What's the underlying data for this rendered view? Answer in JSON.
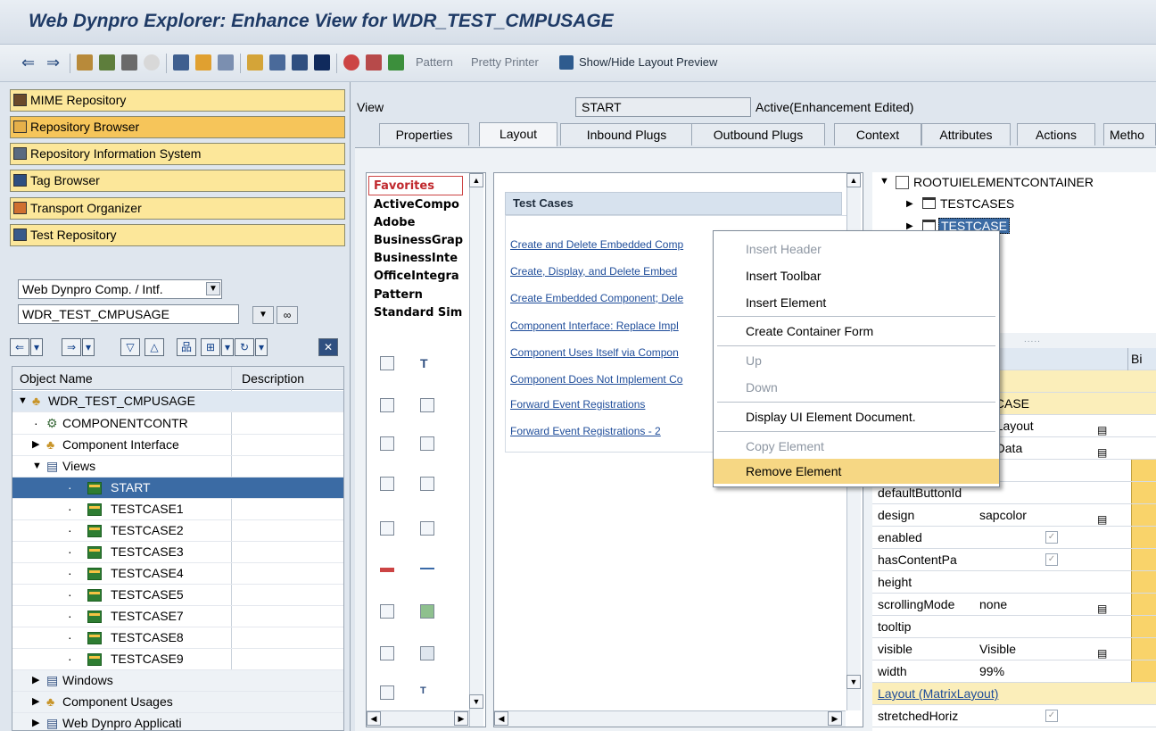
{
  "window": {
    "title": "Web Dynpro Explorer: Enhance View for WDR_TEST_CMPUSAGE"
  },
  "toolbar": {
    "pattern_label": "Pattern",
    "pretty_printer_label": "Pretty Printer",
    "layout_preview_label": "Show/Hide Layout Preview"
  },
  "nav": {
    "items": [
      {
        "label": "MIME Repository"
      },
      {
        "label": "Repository Browser"
      },
      {
        "label": "Repository Information System"
      },
      {
        "label": "Tag Browser"
      },
      {
        "label": "Transport Organizer"
      },
      {
        "label": "Test Repository"
      }
    ],
    "object_type": "Web Dynpro Comp. / Intf.",
    "object_name": "WDR_TEST_CMPUSAGE"
  },
  "object_tree": {
    "col_name": "Object Name",
    "col_desc": "Description",
    "rows": [
      {
        "label": "WDR_TEST_CMPUSAGE"
      },
      {
        "label": "COMPONENTCONTR"
      },
      {
        "label": "Component Interface"
      },
      {
        "label": "Views"
      },
      {
        "label": "START"
      },
      {
        "label": "TESTCASE1"
      },
      {
        "label": "TESTCASE2"
      },
      {
        "label": "TESTCASE3"
      },
      {
        "label": "TESTCASE4"
      },
      {
        "label": "TESTCASE5"
      },
      {
        "label": "TESTCASE7"
      },
      {
        "label": "TESTCASE8"
      },
      {
        "label": "TESTCASE9"
      },
      {
        "label": "Windows"
      },
      {
        "label": "Component Usages"
      },
      {
        "label": "Web Dynpro Applicati"
      }
    ]
  },
  "view_header": {
    "view_label": "View",
    "view_name": "START",
    "status": "Active(Enhancement Edited)"
  },
  "tabs": [
    {
      "label": "Properties"
    },
    {
      "label": "Layout"
    },
    {
      "label": "Inbound Plugs"
    },
    {
      "label": "Outbound Plugs"
    },
    {
      "label": "Context"
    },
    {
      "label": "Attributes"
    },
    {
      "label": "Actions"
    },
    {
      "label": "Metho"
    }
  ],
  "palette": {
    "items": [
      {
        "label": "Favorites"
      },
      {
        "label": "ActiveCompo"
      },
      {
        "label": "Adobe"
      },
      {
        "label": "BusinessGrap"
      },
      {
        "label": "BusinessInte"
      },
      {
        "label": "OfficeIntegra"
      },
      {
        "label": "Pattern"
      },
      {
        "label": "Standard Sim"
      }
    ]
  },
  "canvas": {
    "header": "Test Cases",
    "links": [
      {
        "text": "Create and Delete Embedded Comp"
      },
      {
        "text": "Create, Display, and Delete Embed"
      },
      {
        "text": "Create Embedded Component; Dele"
      },
      {
        "text": "Component Interface: Replace Impl"
      },
      {
        "text": "Component Uses Itself via Compon"
      },
      {
        "text": "Component Does Not Implement Co"
      },
      {
        "text": "Forward Event Registrations"
      },
      {
        "text": "Forward Event Registrations - 2"
      }
    ]
  },
  "ui_tree": {
    "root": "ROOTUIELEMENTCONTAINER",
    "children": [
      {
        "label": "TESTCASES"
      },
      {
        "label": "TESTCASE"
      }
    ]
  },
  "properties": {
    "col_value": "ue",
    "col_binding": "Bi",
    "rows": [
      {
        "name": "",
        "value": "STCASE"
      },
      {
        "name": "",
        "value": "trixLayout"
      },
      {
        "name": "",
        "value": "trixData"
      },
      {
        "name": "",
        "value": ""
      },
      {
        "name": "defaultButtonId",
        "value": ""
      },
      {
        "name": "design",
        "value": "sapcolor"
      },
      {
        "name": "enabled",
        "value": ""
      },
      {
        "name": "hasContentPa",
        "value": ""
      },
      {
        "name": "height",
        "value": ""
      },
      {
        "name": "scrollingMode",
        "value": "none"
      },
      {
        "name": "tooltip",
        "value": ""
      },
      {
        "name": "visible",
        "value": "Visible"
      },
      {
        "name": "width",
        "value": "99%"
      },
      {
        "name": "Layout (MatrixLayout)",
        "value": ""
      },
      {
        "name": "stretchedHoriz",
        "value": ""
      }
    ]
  },
  "context_menu": {
    "items": [
      {
        "label": "Insert Header",
        "enabled": false
      },
      {
        "label": "Insert Toolbar",
        "enabled": true
      },
      {
        "label": "Insert Element",
        "enabled": true
      },
      {
        "label": "Create Container Form",
        "enabled": true
      },
      {
        "label": "Up",
        "enabled": false
      },
      {
        "label": "Down",
        "enabled": false
      },
      {
        "label": "Display UI Element Document.",
        "enabled": true
      },
      {
        "label": "Copy Element",
        "enabled": false
      },
      {
        "label": "Remove Element",
        "enabled": true,
        "highlighted": true
      }
    ]
  },
  "colors": {
    "title_text": "#1f3b66",
    "nav_button": "#fce79a",
    "nav_button_active": "#f6c55a",
    "selection": "#3b6ba4",
    "menu_highlight": "#f6d784",
    "link": "#1f4d9a"
  }
}
